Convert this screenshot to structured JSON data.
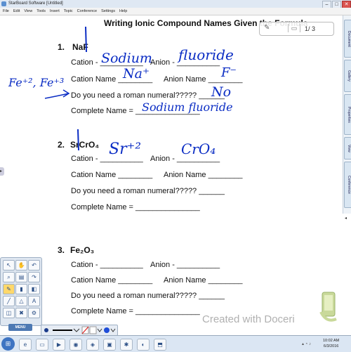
{
  "window": {
    "title": "StarBoard Software [Untitled]"
  },
  "menu": [
    "File",
    "Edit",
    "View",
    "Tools",
    "Insert",
    "Topic",
    "Conference",
    "Settings",
    "Help"
  ],
  "sidetabs": [
    "Document",
    "Gallery",
    "Properties",
    "View",
    "Conference"
  ],
  "page_nav": {
    "indicator": "1/ 3"
  },
  "worksheet": {
    "title": "Writing Ionic Compound Names Given the Formula",
    "problems": [
      {
        "number": "1.",
        "formula": "NaF",
        "cation_label": "Cation - ",
        "cation_blank": "__________",
        "anion_label": "Anion - ",
        "anion_blank": "__________",
        "cation_name_label": "Cation Name",
        "cation_name_blank": "________",
        "anion_name_label": "Anion Name",
        "anion_name_blank": "________",
        "roman_q": "Do you need a roman numeral?????",
        "roman_blank": "______",
        "complete_label": "Complete Name =",
        "complete_blank": "_______________"
      },
      {
        "number": "2.",
        "formula": "SrCrO₄",
        "cation_label": "Cation - ",
        "cation_blank": "__________",
        "anion_label": "Anion - ",
        "anion_blank": "__________",
        "cation_name_label": "Cation Name",
        "cation_name_blank": "________",
        "anion_name_label": "Anion Name",
        "anion_name_blank": "________",
        "roman_q": "Do you need a roman numeral?????",
        "roman_blank": "______",
        "complete_label": "Complete Name =",
        "complete_blank": "_______________"
      },
      {
        "number": "3.",
        "formula": "Fe₂O₃",
        "cation_label": "Cation - ",
        "cation_blank": "__________",
        "anion_label": "Anion - ",
        "anion_blank": "__________",
        "cation_name_label": "Cation Name",
        "cation_name_blank": "________",
        "anion_name_label": "Anion Name",
        "anion_name_blank": "________",
        "roman_q": "Do you need a roman numeral?????",
        "roman_blank": "______",
        "complete_label": "Complete Name =",
        "complete_blank": "_______________"
      }
    ]
  },
  "handwriting": {
    "p1_cation": "Sodium",
    "p1_anion": "fluoride",
    "p1_cation_name": "Na⁺",
    "p1_anion_name": "F⁻",
    "p1_roman": "No",
    "p1_complete": "Sodium fluoride",
    "side_note": "Fe⁺², Fe⁺³",
    "p2_cation": "Sr⁺²",
    "p2_anion": "CrO₄"
  },
  "toolbox": {
    "menu_label": "MENU"
  },
  "taskbar": {
    "time": "10:02 AM",
    "date": "6/3/2016"
  },
  "watermark": "Created with Doceri",
  "colors": {
    "ink": "#0b2dc4",
    "accent": "#3e74c2"
  }
}
